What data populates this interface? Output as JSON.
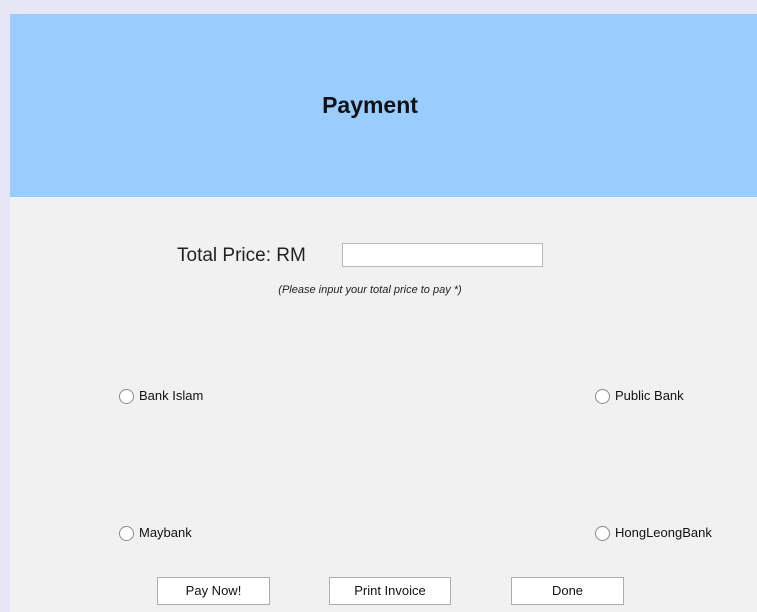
{
  "header": {
    "title": "Payment",
    "background_color": "#99ccff"
  },
  "price": {
    "label": "Total Price:  RM",
    "input_value": "",
    "hint": "(Please input your total price to pay *)"
  },
  "banks": {
    "bank_islam": "Bank Islam",
    "public_bank": "Public Bank",
    "maybank": "Maybank",
    "hongleong": "HongLeongBank"
  },
  "buttons": {
    "pay_now": "Pay Now!",
    "print_invoice": "Print Invoice",
    "done": "Done"
  }
}
